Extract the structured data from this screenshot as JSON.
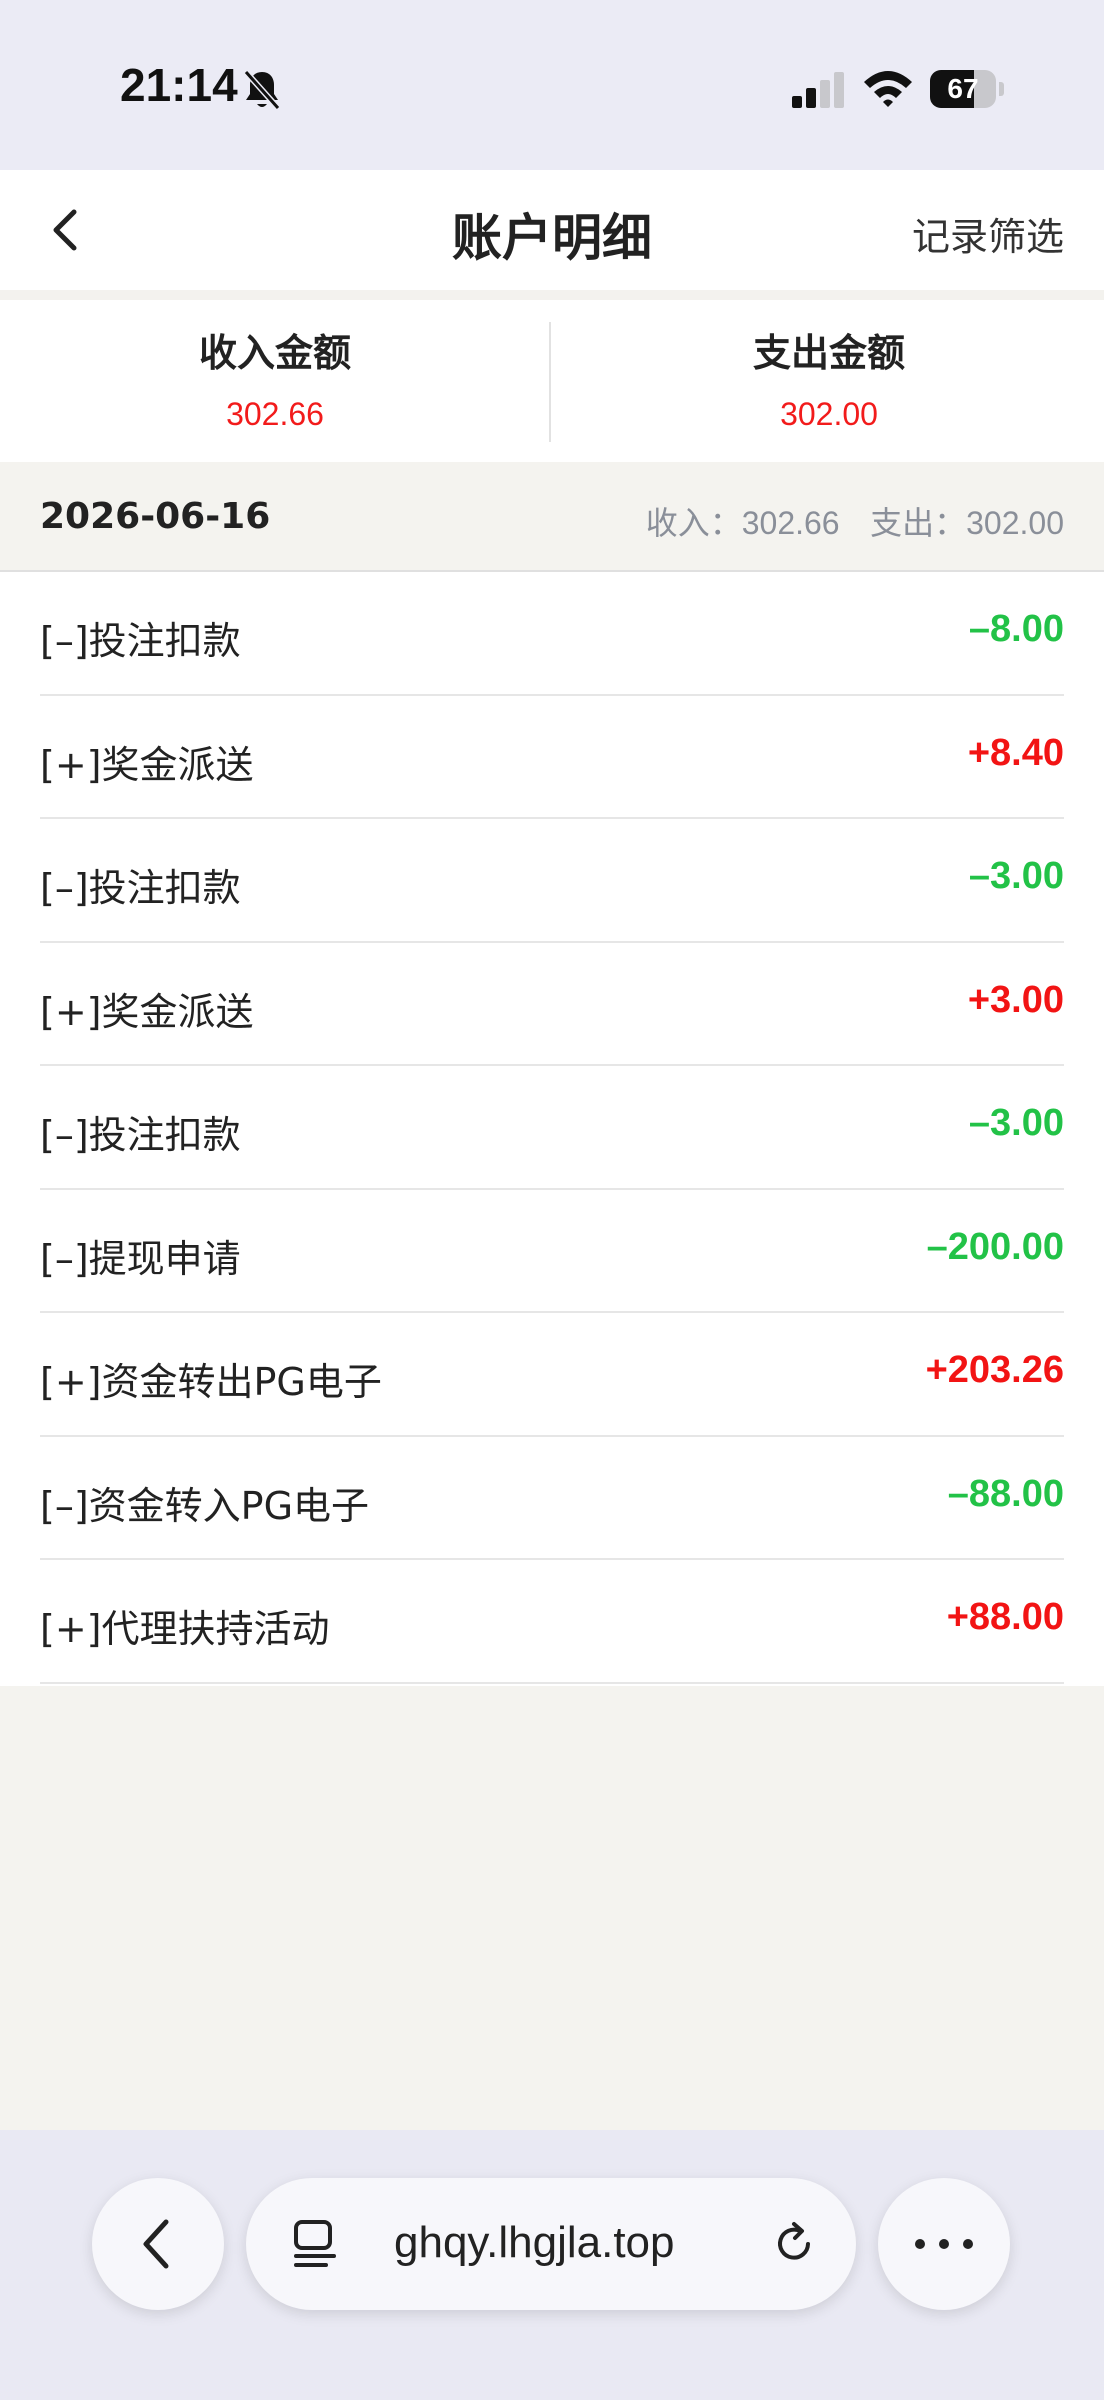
{
  "status_bar": {
    "time": "21:14",
    "battery": "67",
    "battery_level": 0.67
  },
  "header": {
    "title": "账户明细",
    "filter_label": "记录筛选"
  },
  "summary": {
    "income_label": "收入金额",
    "income_value": "302.66",
    "expense_label": "支出金额",
    "expense_value": "302.00"
  },
  "day": {
    "date": "2026-06-16",
    "income_prefix": "收入：",
    "income": "302.66",
    "expense_prefix": "支出：",
    "expense": "302.00"
  },
  "transactions": [
    {
      "label": "[–]投注扣款",
      "amount": "–8.00",
      "sign": "neg"
    },
    {
      "label": "[+]奖金派送",
      "amount": "+8.40",
      "sign": "pos"
    },
    {
      "label": "[–]投注扣款",
      "amount": "–3.00",
      "sign": "neg"
    },
    {
      "label": "[+]奖金派送",
      "amount": "+3.00",
      "sign": "pos"
    },
    {
      "label": "[–]投注扣款",
      "amount": "–3.00",
      "sign": "neg"
    },
    {
      "label": "[–]提现申请",
      "amount": "–200.00",
      "sign": "neg"
    },
    {
      "label": "[+]资金转出PG电子",
      "amount": "+203.26",
      "sign": "pos"
    },
    {
      "label": "[–]资金转入PG电子",
      "amount": "–88.00",
      "sign": "neg"
    },
    {
      "label": "[+]代理扶持活动",
      "amount": "+88.00",
      "sign": "pos"
    }
  ],
  "browser": {
    "url": "ghqy.lhgjla.top"
  },
  "colors": {
    "income_red": "#f21414",
    "expense_green": "#22c247"
  }
}
